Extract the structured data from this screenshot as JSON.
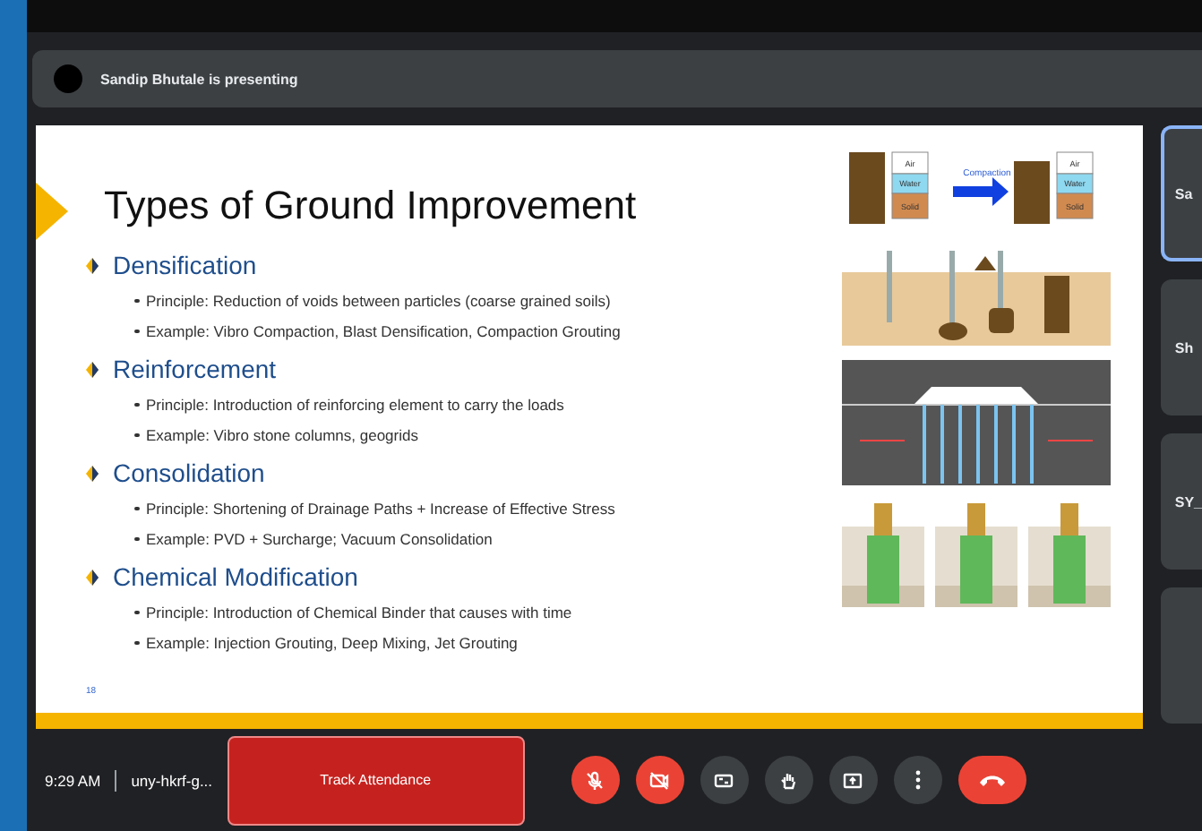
{
  "presenting_bar": {
    "text": "Sandip Bhutale is presenting"
  },
  "slide": {
    "title": "Types of Ground Improvement",
    "page_number": "18",
    "sections": [
      {
        "heading": "Densification",
        "bullets": [
          "Principle: Reduction of voids between particles (coarse grained soils)",
          "Example: Vibro Compaction, Blast Densification, Compaction Grouting"
        ]
      },
      {
        "heading": "Reinforcement",
        "bullets": [
          "Principle: Introduction of reinforcing element to carry the loads",
          "Example: Vibro stone columns, geogrids"
        ]
      },
      {
        "heading": "Consolidation",
        "bullets": [
          "Principle: Shortening of Drainage Paths + Increase of Effective Stress",
          "Example: PVD + Surcharge; Vacuum Consolidation"
        ]
      },
      {
        "heading": "Chemical Modification",
        "bullets": [
          "Principle: Introduction of Chemical Binder that causes with time",
          "Example: Injection Grouting, Deep Mixing, Jet Grouting"
        ]
      }
    ],
    "phase_labels": [
      "Air",
      "Water",
      "Solid",
      "Air",
      "Water",
      "Solid"
    ],
    "arrow_label": "Compaction"
  },
  "participants": [
    {
      "name": "Sa",
      "selected": true
    },
    {
      "name": "Sh",
      "selected": false
    },
    {
      "name": "SY_",
      "selected": false
    },
    {
      "selected": false
    }
  ],
  "bottom_bar": {
    "time": "9:29 AM",
    "meeting_code": "uny-hkrf-g...",
    "attendance_button": "Track Attendance",
    "controls": [
      {
        "kind": "mic",
        "on": false
      },
      {
        "kind": "camera",
        "on": false
      },
      {
        "kind": "captions"
      },
      {
        "kind": "hand"
      },
      {
        "kind": "present"
      },
      {
        "kind": "more"
      },
      {
        "kind": "hangup"
      }
    ]
  }
}
